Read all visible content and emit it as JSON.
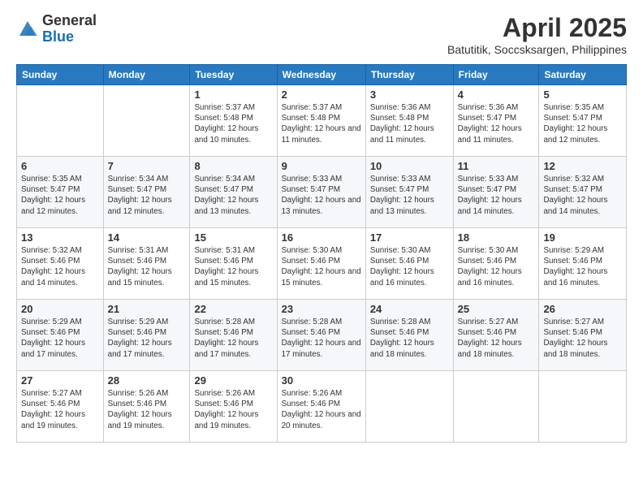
{
  "logo": {
    "general": "General",
    "blue": "Blue"
  },
  "title": "April 2025",
  "subtitle": "Batutitik, Soccsksargen, Philippines",
  "days_of_week": [
    "Sunday",
    "Monday",
    "Tuesday",
    "Wednesday",
    "Thursday",
    "Friday",
    "Saturday"
  ],
  "weeks": [
    [
      {
        "day": "",
        "sunrise": "",
        "sunset": "",
        "daylight": ""
      },
      {
        "day": "",
        "sunrise": "",
        "sunset": "",
        "daylight": ""
      },
      {
        "day": "1",
        "sunrise": "Sunrise: 5:37 AM",
        "sunset": "Sunset: 5:48 PM",
        "daylight": "Daylight: 12 hours and 10 minutes."
      },
      {
        "day": "2",
        "sunrise": "Sunrise: 5:37 AM",
        "sunset": "Sunset: 5:48 PM",
        "daylight": "Daylight: 12 hours and 11 minutes."
      },
      {
        "day": "3",
        "sunrise": "Sunrise: 5:36 AM",
        "sunset": "Sunset: 5:48 PM",
        "daylight": "Daylight: 12 hours and 11 minutes."
      },
      {
        "day": "4",
        "sunrise": "Sunrise: 5:36 AM",
        "sunset": "Sunset: 5:47 PM",
        "daylight": "Daylight: 12 hours and 11 minutes."
      },
      {
        "day": "5",
        "sunrise": "Sunrise: 5:35 AM",
        "sunset": "Sunset: 5:47 PM",
        "daylight": "Daylight: 12 hours and 12 minutes."
      }
    ],
    [
      {
        "day": "6",
        "sunrise": "Sunrise: 5:35 AM",
        "sunset": "Sunset: 5:47 PM",
        "daylight": "Daylight: 12 hours and 12 minutes."
      },
      {
        "day": "7",
        "sunrise": "Sunrise: 5:34 AM",
        "sunset": "Sunset: 5:47 PM",
        "daylight": "Daylight: 12 hours and 12 minutes."
      },
      {
        "day": "8",
        "sunrise": "Sunrise: 5:34 AM",
        "sunset": "Sunset: 5:47 PM",
        "daylight": "Daylight: 12 hours and 13 minutes."
      },
      {
        "day": "9",
        "sunrise": "Sunrise: 5:33 AM",
        "sunset": "Sunset: 5:47 PM",
        "daylight": "Daylight: 12 hours and 13 minutes."
      },
      {
        "day": "10",
        "sunrise": "Sunrise: 5:33 AM",
        "sunset": "Sunset: 5:47 PM",
        "daylight": "Daylight: 12 hours and 13 minutes."
      },
      {
        "day": "11",
        "sunrise": "Sunrise: 5:33 AM",
        "sunset": "Sunset: 5:47 PM",
        "daylight": "Daylight: 12 hours and 14 minutes."
      },
      {
        "day": "12",
        "sunrise": "Sunrise: 5:32 AM",
        "sunset": "Sunset: 5:47 PM",
        "daylight": "Daylight: 12 hours and 14 minutes."
      }
    ],
    [
      {
        "day": "13",
        "sunrise": "Sunrise: 5:32 AM",
        "sunset": "Sunset: 5:46 PM",
        "daylight": "Daylight: 12 hours and 14 minutes."
      },
      {
        "day": "14",
        "sunrise": "Sunrise: 5:31 AM",
        "sunset": "Sunset: 5:46 PM",
        "daylight": "Daylight: 12 hours and 15 minutes."
      },
      {
        "day": "15",
        "sunrise": "Sunrise: 5:31 AM",
        "sunset": "Sunset: 5:46 PM",
        "daylight": "Daylight: 12 hours and 15 minutes."
      },
      {
        "day": "16",
        "sunrise": "Sunrise: 5:30 AM",
        "sunset": "Sunset: 5:46 PM",
        "daylight": "Daylight: 12 hours and 15 minutes."
      },
      {
        "day": "17",
        "sunrise": "Sunrise: 5:30 AM",
        "sunset": "Sunset: 5:46 PM",
        "daylight": "Daylight: 12 hours and 16 minutes."
      },
      {
        "day": "18",
        "sunrise": "Sunrise: 5:30 AM",
        "sunset": "Sunset: 5:46 PM",
        "daylight": "Daylight: 12 hours and 16 minutes."
      },
      {
        "day": "19",
        "sunrise": "Sunrise: 5:29 AM",
        "sunset": "Sunset: 5:46 PM",
        "daylight": "Daylight: 12 hours and 16 minutes."
      }
    ],
    [
      {
        "day": "20",
        "sunrise": "Sunrise: 5:29 AM",
        "sunset": "Sunset: 5:46 PM",
        "daylight": "Daylight: 12 hours and 17 minutes."
      },
      {
        "day": "21",
        "sunrise": "Sunrise: 5:29 AM",
        "sunset": "Sunset: 5:46 PM",
        "daylight": "Daylight: 12 hours and 17 minutes."
      },
      {
        "day": "22",
        "sunrise": "Sunrise: 5:28 AM",
        "sunset": "Sunset: 5:46 PM",
        "daylight": "Daylight: 12 hours and 17 minutes."
      },
      {
        "day": "23",
        "sunrise": "Sunrise: 5:28 AM",
        "sunset": "Sunset: 5:46 PM",
        "daylight": "Daylight: 12 hours and 17 minutes."
      },
      {
        "day": "24",
        "sunrise": "Sunrise: 5:28 AM",
        "sunset": "Sunset: 5:46 PM",
        "daylight": "Daylight: 12 hours and 18 minutes."
      },
      {
        "day": "25",
        "sunrise": "Sunrise: 5:27 AM",
        "sunset": "Sunset: 5:46 PM",
        "daylight": "Daylight: 12 hours and 18 minutes."
      },
      {
        "day": "26",
        "sunrise": "Sunrise: 5:27 AM",
        "sunset": "Sunset: 5:46 PM",
        "daylight": "Daylight: 12 hours and 18 minutes."
      }
    ],
    [
      {
        "day": "27",
        "sunrise": "Sunrise: 5:27 AM",
        "sunset": "Sunset: 5:46 PM",
        "daylight": "Daylight: 12 hours and 19 minutes."
      },
      {
        "day": "28",
        "sunrise": "Sunrise: 5:26 AM",
        "sunset": "Sunset: 5:46 PM",
        "daylight": "Daylight: 12 hours and 19 minutes."
      },
      {
        "day": "29",
        "sunrise": "Sunrise: 5:26 AM",
        "sunset": "Sunset: 5:46 PM",
        "daylight": "Daylight: 12 hours and 19 minutes."
      },
      {
        "day": "30",
        "sunrise": "Sunrise: 5:26 AM",
        "sunset": "Sunset: 5:46 PM",
        "daylight": "Daylight: 12 hours and 20 minutes."
      },
      {
        "day": "",
        "sunrise": "",
        "sunset": "",
        "daylight": ""
      },
      {
        "day": "",
        "sunrise": "",
        "sunset": "",
        "daylight": ""
      },
      {
        "day": "",
        "sunrise": "",
        "sunset": "",
        "daylight": ""
      }
    ]
  ]
}
